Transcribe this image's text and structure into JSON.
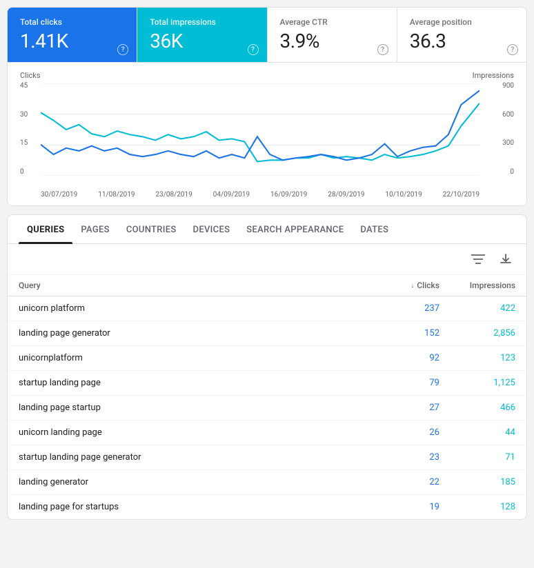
{
  "stats": {
    "total_clicks": {
      "label": "Total clicks",
      "value": "1.41K",
      "bg": "blue"
    },
    "total_impressions": {
      "label": "Total impressions",
      "value": "36K",
      "bg": "teal"
    },
    "average_ctr": {
      "label": "Average CTR",
      "value": "3.9%",
      "bg": "plain"
    },
    "average_position": {
      "label": "Average position",
      "value": "36.3",
      "bg": "plain"
    }
  },
  "chart": {
    "left_axis_label": "Clicks",
    "right_axis_label": "Impressions",
    "left_ticks": [
      "45",
      "30",
      "15",
      "0"
    ],
    "right_ticks": [
      "900",
      "600",
      "300",
      "0"
    ],
    "x_dates": [
      "30/07/2019",
      "11/08/2019",
      "23/08/2019",
      "04/09/2019",
      "16/09/2019",
      "28/09/2019",
      "10/10/2019",
      "22/10/2019"
    ]
  },
  "tabs": [
    {
      "label": "QUERIES",
      "active": true
    },
    {
      "label": "PAGES",
      "active": false
    },
    {
      "label": "COUNTRIES",
      "active": false
    },
    {
      "label": "DEVICES",
      "active": false
    },
    {
      "label": "SEARCH APPEARANCE",
      "active": false
    },
    {
      "label": "DATES",
      "active": false
    }
  ],
  "table": {
    "columns": {
      "query": "Query",
      "clicks": "Clicks",
      "impressions": "Impressions"
    },
    "rows": [
      {
        "query": "unicorn platform",
        "clicks": "237",
        "impressions": "422"
      },
      {
        "query": "landing page generator",
        "clicks": "152",
        "impressions": "2,856"
      },
      {
        "query": "unicornplatform",
        "clicks": "92",
        "impressions": "123"
      },
      {
        "query": "startup landing page",
        "clicks": "79",
        "impressions": "1,125"
      },
      {
        "query": "landing page startup",
        "clicks": "27",
        "impressions": "466"
      },
      {
        "query": "unicorn landing page",
        "clicks": "26",
        "impressions": "44"
      },
      {
        "query": "startup landing page generator",
        "clicks": "23",
        "impressions": "71"
      },
      {
        "query": "landing generator",
        "clicks": "22",
        "impressions": "185"
      },
      {
        "query": "landing page for startups",
        "clicks": "19",
        "impressions": "128"
      }
    ]
  },
  "icons": {
    "filter": "≡",
    "download": "⬇",
    "sort_down": "↓"
  }
}
